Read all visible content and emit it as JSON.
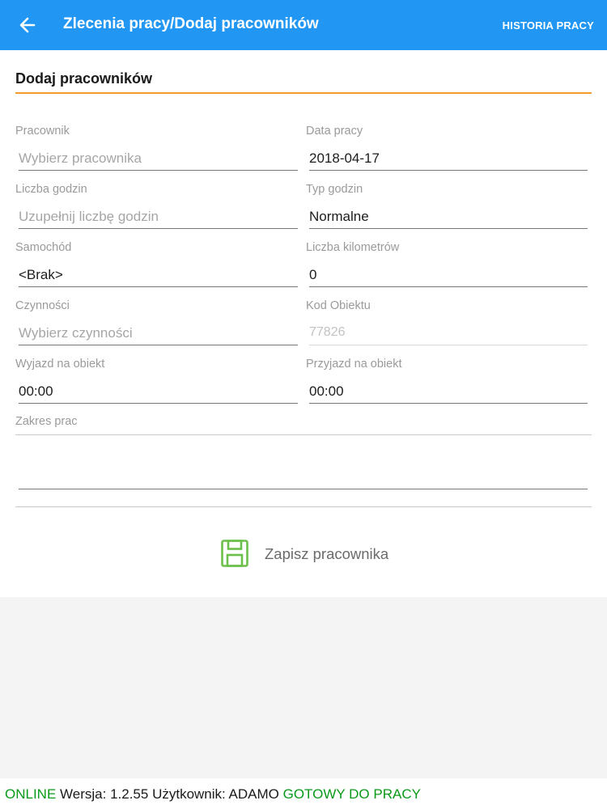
{
  "appbar": {
    "title": "Zlecenia pracy/Dodaj pracowników",
    "history_label": "HISTORIA PRACY",
    "accent_color": "#2196f3"
  },
  "section": {
    "title": "Dodaj pracowników",
    "underline_color": "#f39c2b"
  },
  "fields": {
    "pracownik": {
      "label": "Pracownik",
      "placeholder": "Wybierz pracownika"
    },
    "data_pracy": {
      "label": "Data pracy",
      "value": "2018-04-17"
    },
    "liczba_godzin": {
      "label": "Liczba godzin",
      "placeholder": "Uzupełnij liczbę godzin"
    },
    "typ_godzin": {
      "label": "Typ godzin",
      "value": "Normalne"
    },
    "samochod": {
      "label": "Samochód",
      "value": "<Brak>"
    },
    "liczba_km": {
      "label": "Liczba kilometrów",
      "value": "0"
    },
    "czynnosci": {
      "label": "Czynności",
      "placeholder": "Wybierz czynności"
    },
    "kod_obiektu": {
      "label": "Kod Obiektu",
      "value": "77826"
    },
    "wyjazd": {
      "label": "Wyjazd na obiekt",
      "value": "00:00"
    },
    "przyjazd": {
      "label": "Przyjazd na obiekt",
      "value": "00:00"
    },
    "zakres_prac": {
      "label": "Zakres prac",
      "value": ""
    }
  },
  "save": {
    "label": "Zapisz pracownika",
    "icon": "floppy-disk-icon",
    "icon_color": "#6cbf4a"
  },
  "status": {
    "online": "ONLINE",
    "version_text": "Wersja: 1.2.55",
    "user_text": "Użytkownik: ADAMO",
    "ready": "GOTOWY DO PRACY",
    "status_color": "#0a9a1a"
  }
}
